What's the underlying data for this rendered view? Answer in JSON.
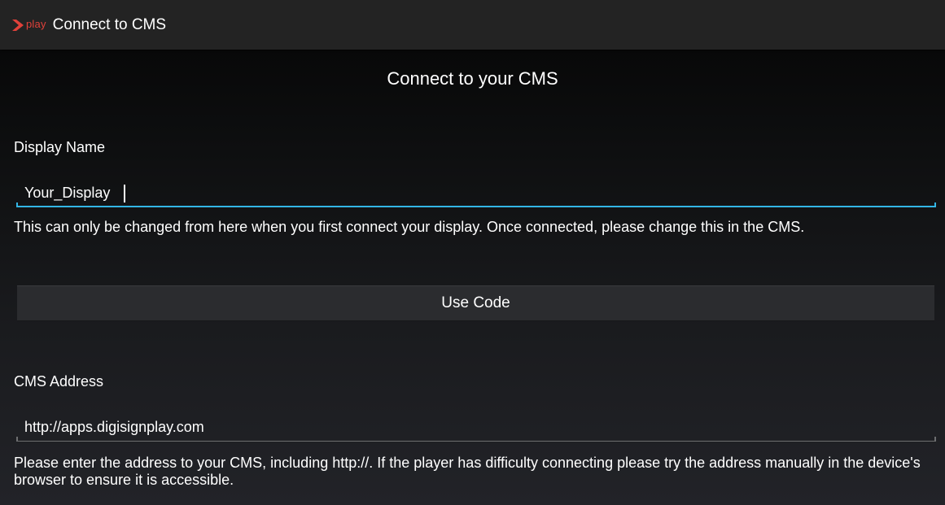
{
  "action_bar": {
    "logo_text": "play",
    "title": "Connect to CMS"
  },
  "heading": "Connect to your CMS",
  "display_name": {
    "label": "Display Name",
    "value": "Your_Display",
    "hint": "This can only be changed from here when you first connect your display. Once connected, please change this in the CMS."
  },
  "use_code_button": {
    "label": "Use Code"
  },
  "cms_address": {
    "label": "CMS Address",
    "value": "http://apps.digisignplay.com",
    "hint": "Please enter the address to your CMS, including http://. If the player has difficulty connecting please try the address manually in the device's browser to ensure it is accessible."
  },
  "colors": {
    "accent": "#33b5e5",
    "logo": "#e0413a",
    "action_bar": "#232323"
  },
  "icons": {
    "logo": "play-chevron-icon"
  }
}
